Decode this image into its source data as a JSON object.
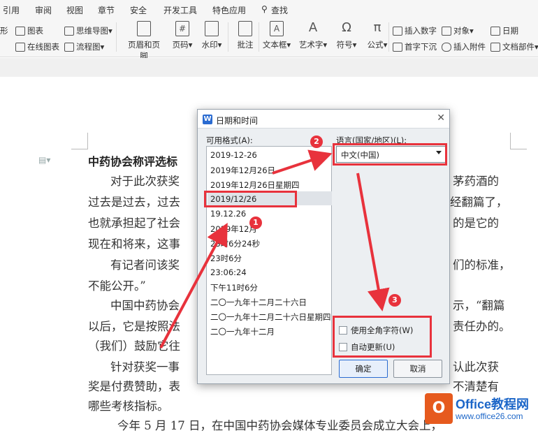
{
  "menu": [
    "引用",
    "审阅",
    "视图",
    "章节",
    "安全",
    "开发工具",
    "特色应用",
    "查找"
  ],
  "ribbon": {
    "small_left_top": [
      "形",
      "图表",
      "思维导图"
    ],
    "small_left_bottom": [
      "在线图表",
      "流程图"
    ],
    "big": [
      "页眉和页脚",
      "页码",
      "水印",
      "批注",
      "文本框",
      "艺术字",
      "符号",
      "公式"
    ],
    "small_right_top": [
      "插入数字",
      "对象",
      "日期"
    ],
    "small_right_bottom": [
      "首字下沉",
      "插入附件",
      "文档部件"
    ]
  },
  "document": {
    "title": "中药协会称评选标",
    "lines": [
      "对于此次获奖",
      "过去是过去，过去",
      "也就承担起了社会",
      "现在和将来，这事",
      "有记者问该奖",
      "不能公开。”",
      "中国中药协会",
      "以后，它是按照法",
      "（我们）鼓励它往",
      "针对获奖一事",
      "奖是付费赞助，表",
      "哪些考核指标。",
      "今年 5 月 17 日，在中国中药协会媒体专业委员会成立大会上，"
    ],
    "right_lines": [
      "茅药酒的",
      "经翻篇了，",
      "的是它的",
      "们的标准，",
      "示，“翻篇",
      "责任办的。",
      "认此次获",
      "不清楚有"
    ]
  },
  "dialog": {
    "title": "日期和时间",
    "formats_label": "可用格式(A):",
    "formats": [
      "2019-12-26",
      "2019年12月26日",
      "2019年12月26日星期四",
      "2019/12/26",
      "19.12.26",
      "2019年12月",
      "23时6分24秒",
      "23时6分",
      "23:06:24",
      "下午11时6分",
      "二〇一九年十二月二十六日",
      "二〇一九年十二月二十六日星期四",
      "二〇一九年十二月"
    ],
    "selected_format": "2019/12/26",
    "language_label": "语言(国家/地区)(L):",
    "language_value": "中文(中国)",
    "fullwidth_label": "使用全角字符(W)",
    "autoupdate_label": "自动更新(U)",
    "ok_label": "确定",
    "cancel_label": "取消"
  },
  "badges": [
    "1",
    "2",
    "3"
  ],
  "watermark": {
    "brand": "Office教程网",
    "url": "www.office26.com"
  },
  "colors": {
    "annotation": "#e8323c",
    "accent": "#2a6bd1",
    "watermark": "#1c66c8"
  }
}
